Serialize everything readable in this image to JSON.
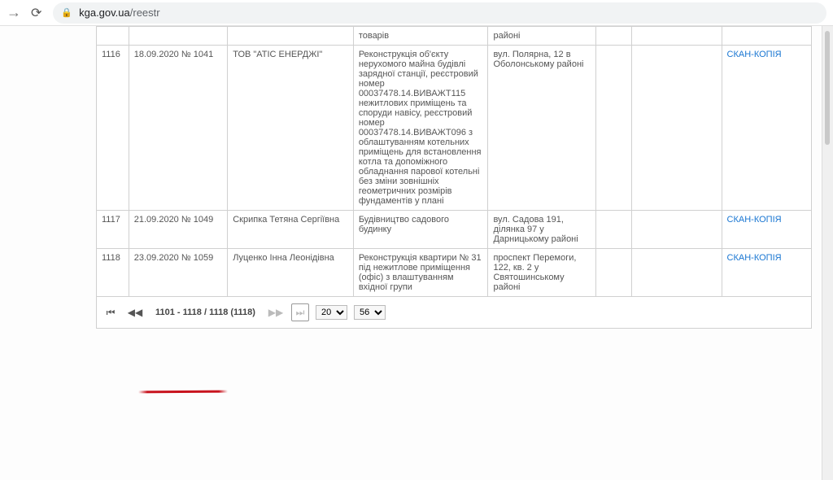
{
  "browser": {
    "url_domain": "kga.gov.ua",
    "url_path": "/reestr"
  },
  "headers": {
    "desc_tail": "товарів",
    "addr_tail": "районі"
  },
  "rows": [
    {
      "n": "1116",
      "date": "18.09.2020 № 1041",
      "applicant": "ТОВ \"АТІС ЕНЕРДЖІ\"",
      "desc": "Реконструкція об'єкту нерухомого майна будівлі зарядної станції, реєстровий номер 00037478.14.ВИВАЖТ115 нежитлових приміщень та споруди навісу, реєстровий номер 00037478.14.ВИВАЖТ096 з облаштуванням котельних приміщень для встановлення котла та допоміжного обладнання парової котельні без зміни зовнішніх геометричних розмірів фундаментів у плані",
      "addr": "вул. Полярна, 12 в Оболонському районі",
      "link": "СКАН-КОПІЯ"
    },
    {
      "n": "1117",
      "date": "21.09.2020 № 1049",
      "applicant": "Скрипка Тетяна Сергіївна",
      "desc": "Будівництво садового будинку",
      "addr": "вул. Садова 191, ділянка 97 у Дарницькому районі",
      "link": "СКАН-КОПІЯ"
    },
    {
      "n": "1118",
      "date": "23.09.2020 № 1059",
      "applicant": "Луценко Інна Леонідівна",
      "desc": "Реконструкція квартири № 31 під нежитлове приміщення (офіс) з влаштуванням вхідної групи",
      "addr": "проспект Перемоги, 122, кв. 2 у Святошинському районі",
      "link": "СКАН-КОПІЯ"
    }
  ],
  "pager": {
    "range_text": "1101 - 1118 / 1118 (1118)",
    "page_size_1": "20",
    "page_size_2": "56"
  }
}
